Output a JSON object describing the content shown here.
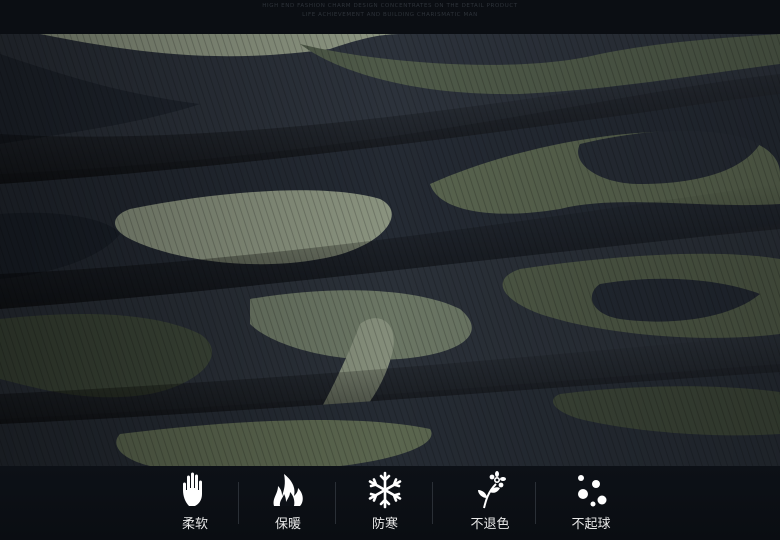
{
  "header": {
    "tagline_1": "HIGH END FASHION CHARM DESIGN CONCENTRATES ON THE DETAIL PRODUCT",
    "tagline_2": "LIFE ACHIEVEMENT AND BUILDING CHARISMATIC MAN"
  },
  "photo": {
    "subject": "camouflage-twill-fabric-folds",
    "palette": {
      "deep_navy": "#1c2430",
      "charcoal": "#2b3038",
      "olive": "#4d5847",
      "sage": "#7d8878",
      "light_khaki": "#9aa291"
    }
  },
  "features": [
    {
      "icon": "hand-icon",
      "label": "柔软"
    },
    {
      "icon": "flame-icon",
      "label": "保暖"
    },
    {
      "icon": "snowflake-icon",
      "label": "防寒"
    },
    {
      "icon": "flower-icon",
      "label": "不退色"
    },
    {
      "icon": "dots-icon",
      "label": "不起球"
    }
  ],
  "colors": {
    "feature_bar_bg": "#0d1117",
    "label_text": "#e8e8e8",
    "icon_fill": "#ffffff"
  }
}
